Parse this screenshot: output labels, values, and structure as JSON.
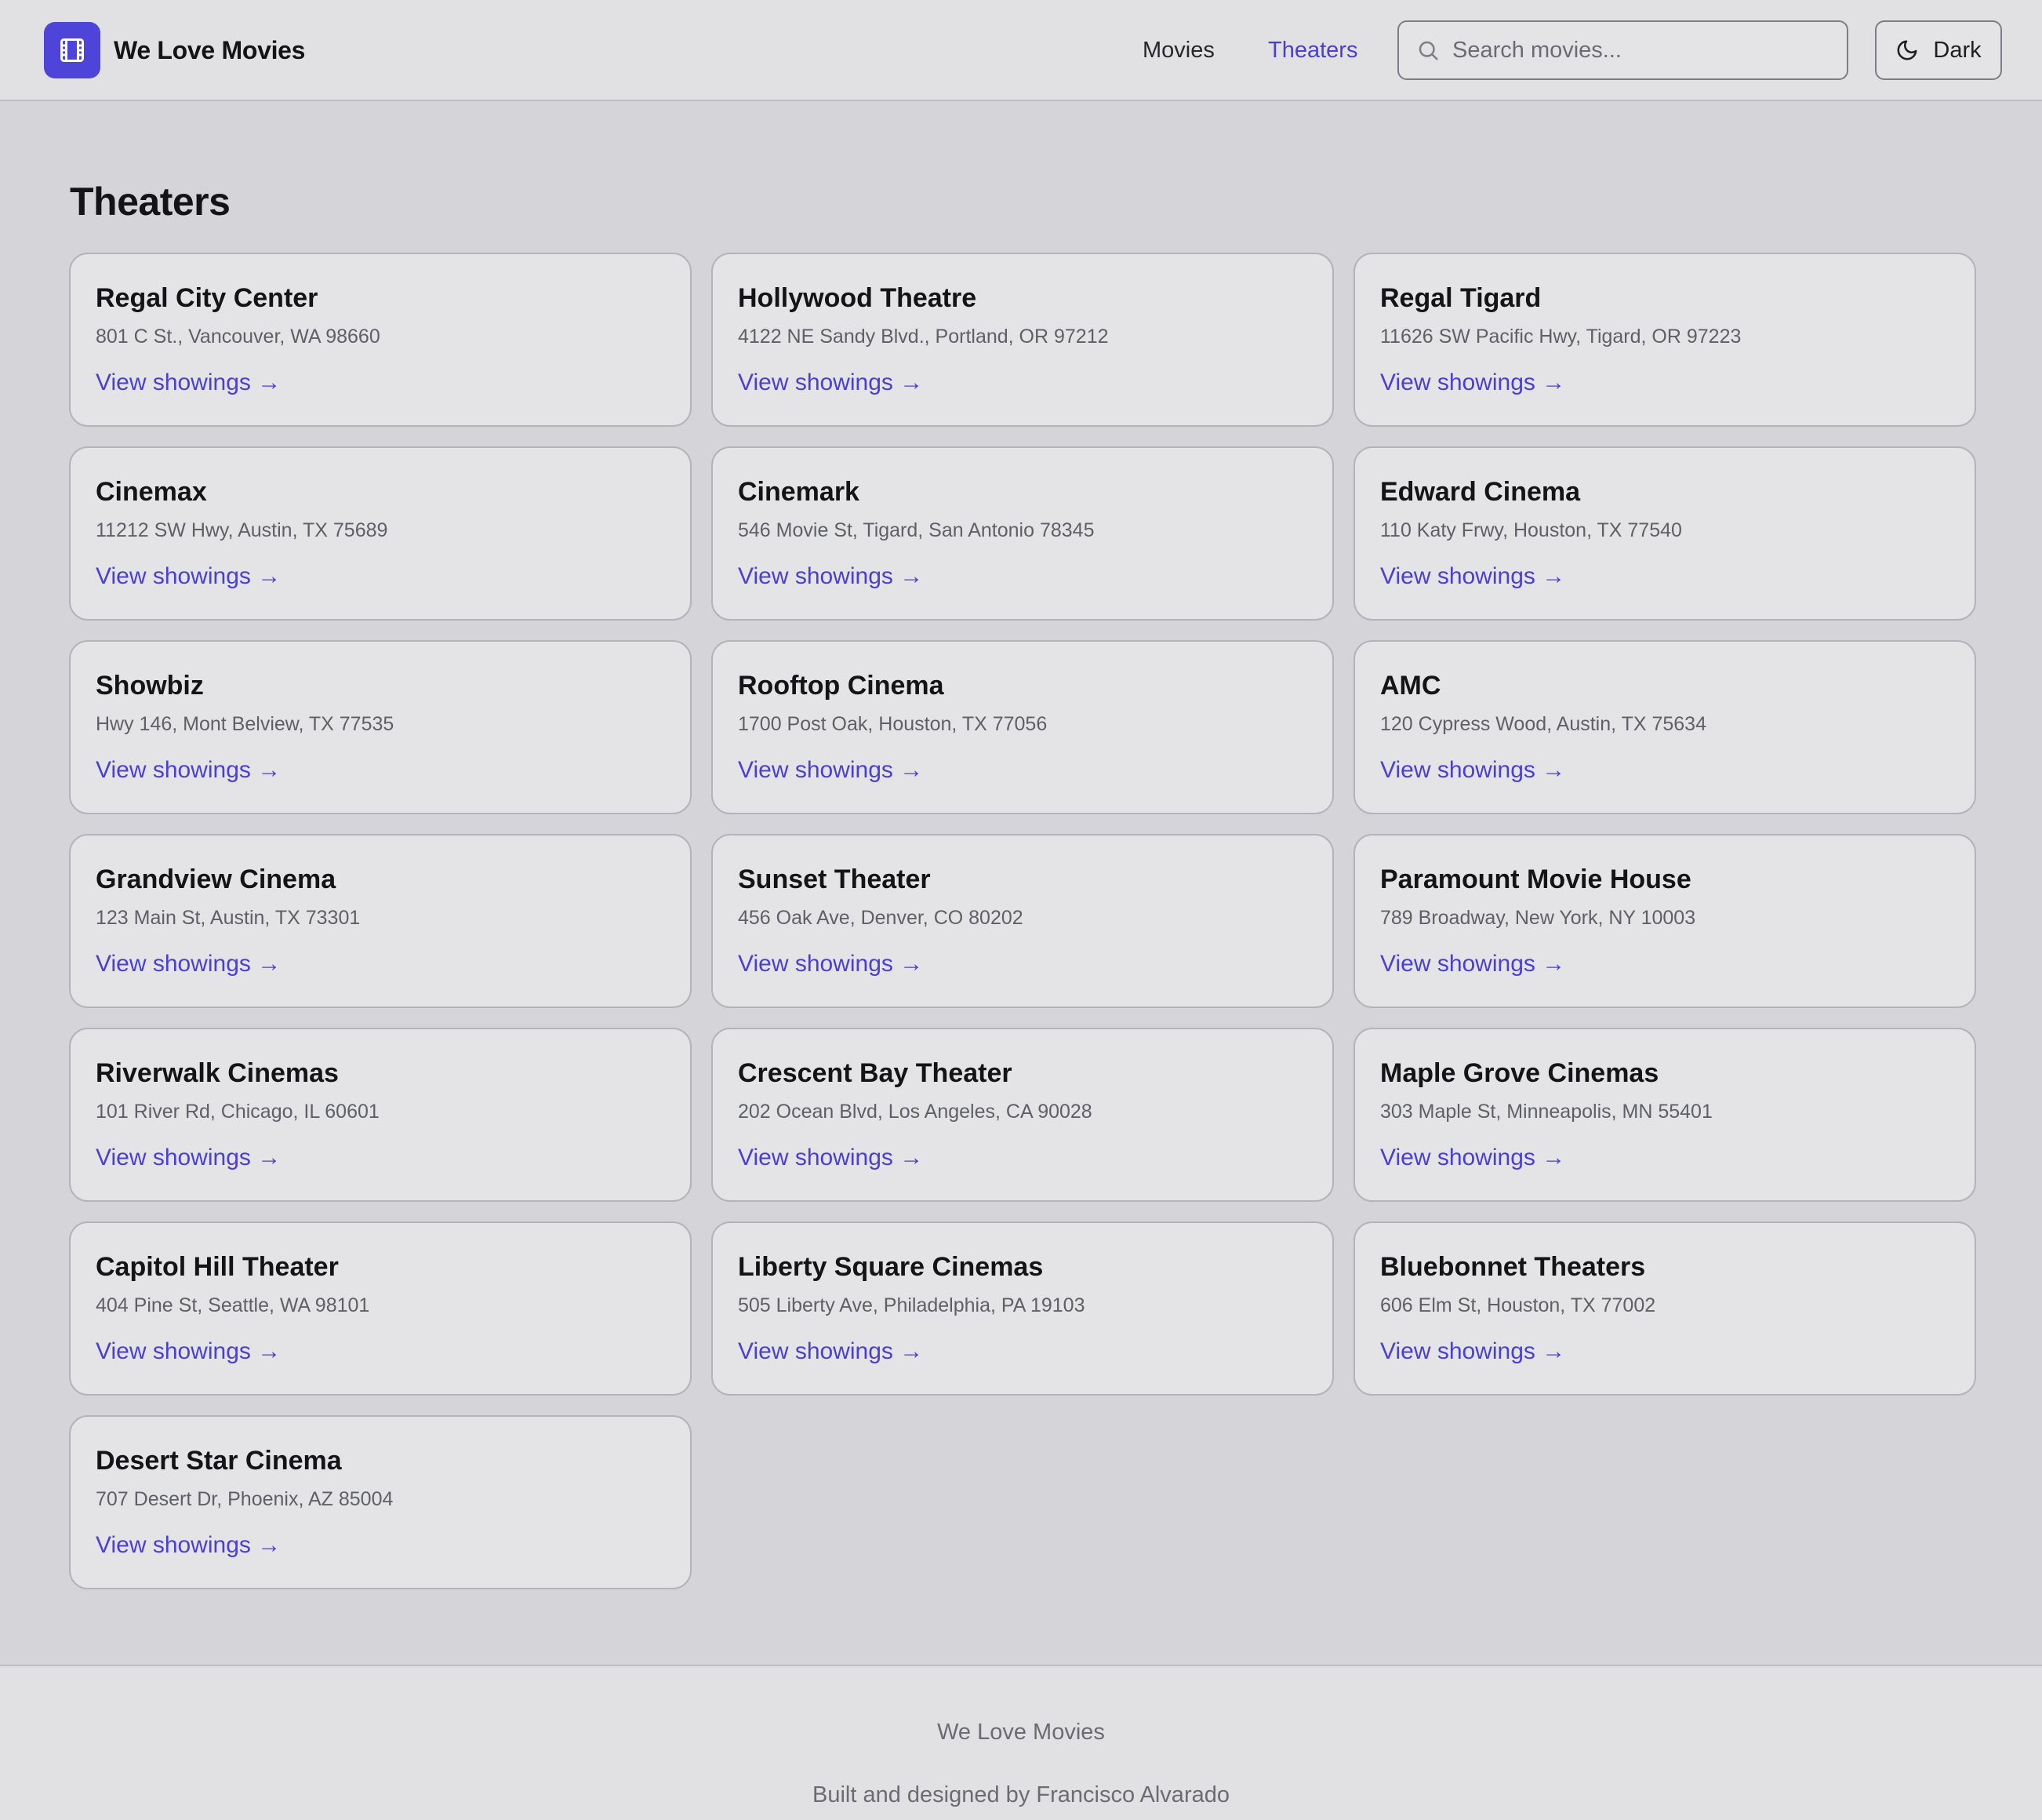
{
  "header": {
    "brand": "We Love Movies",
    "logo_icon": "film-icon",
    "nav": {
      "movies": "Movies",
      "theaters": "Theaters",
      "active": "Theaters"
    },
    "search": {
      "placeholder": "Search movies...",
      "value": "",
      "icon": "search-icon"
    },
    "theme_toggle": {
      "label": "Dark",
      "icon": "moon-icon"
    }
  },
  "main": {
    "title": "Theaters",
    "link_label": "View showings →",
    "theaters": [
      {
        "name": "Regal City Center",
        "address": "801 C St., Vancouver, WA 98660"
      },
      {
        "name": "Hollywood Theatre",
        "address": "4122 NE Sandy Blvd., Portland, OR 97212"
      },
      {
        "name": "Regal Tigard",
        "address": "11626 SW Pacific Hwy, Tigard, OR 97223"
      },
      {
        "name": "Cinemax",
        "address": "11212 SW Hwy, Austin, TX 75689"
      },
      {
        "name": "Cinemark",
        "address": "546 Movie St, Tigard, San Antonio 78345"
      },
      {
        "name": "Edward Cinema",
        "address": "110 Katy Frwy, Houston, TX 77540"
      },
      {
        "name": "Showbiz",
        "address": "Hwy 146, Mont Belview, TX 77535"
      },
      {
        "name": "Rooftop Cinema",
        "address": "1700 Post Oak, Houston, TX 77056"
      },
      {
        "name": "AMC",
        "address": "120 Cypress Wood, Austin, TX 75634"
      },
      {
        "name": "Grandview Cinema",
        "address": "123 Main St, Austin, TX 73301"
      },
      {
        "name": "Sunset Theater",
        "address": "456 Oak Ave, Denver, CO 80202"
      },
      {
        "name": "Paramount Movie House",
        "address": "789 Broadway, New York, NY 10003"
      },
      {
        "name": "Riverwalk Cinemas",
        "address": "101 River Rd, Chicago, IL 60601"
      },
      {
        "name": "Crescent Bay Theater",
        "address": "202 Ocean Blvd, Los Angeles, CA 90028"
      },
      {
        "name": "Maple Grove Cinemas",
        "address": "303 Maple St, Minneapolis, MN 55401"
      },
      {
        "name": "Capitol Hill Theater",
        "address": "404 Pine St, Seattle, WA 98101"
      },
      {
        "name": "Liberty Square Cinemas",
        "address": "505 Liberty Ave, Philadelphia, PA 19103"
      },
      {
        "name": "Bluebonnet Theaters",
        "address": "606 Elm St, Houston, TX 77002"
      },
      {
        "name": "Desert Star Cinema",
        "address": "707 Desert Dr, Phoenix, AZ 85004"
      }
    ]
  },
  "footer": {
    "line1": "We Love Movies",
    "line2": "Built and designed by Francisco Alvarado"
  },
  "colors": {
    "accent": "#4e44d9",
    "link": "#4a3fd1",
    "background": "#d4d4d9",
    "surface": "#e4e4e7"
  }
}
